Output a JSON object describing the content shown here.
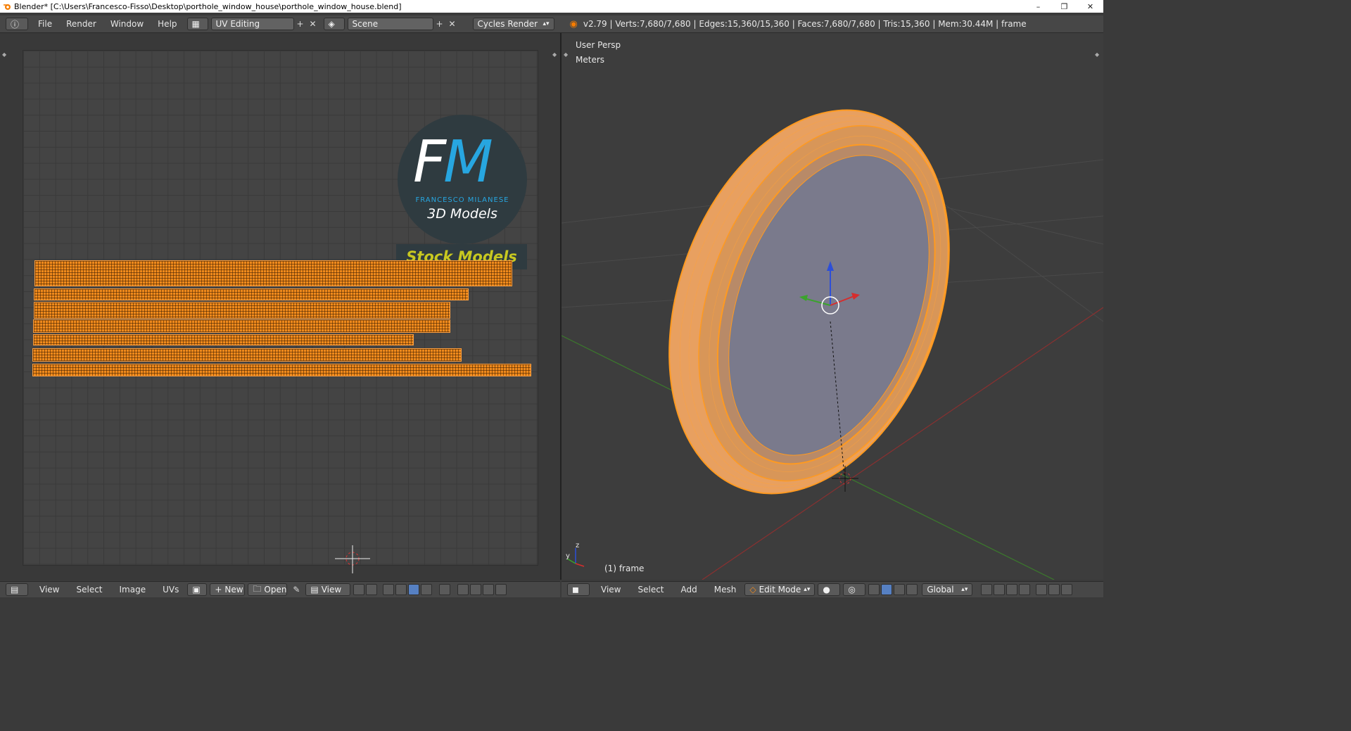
{
  "window": {
    "title": "Blender* [C:\\Users\\Francesco-Fisso\\Desktop\\porthole_window_house\\porthole_window_house.blend]",
    "minimize": "–",
    "maximize": "❐",
    "close": "✕"
  },
  "infobar": {
    "menus": [
      "File",
      "Render",
      "Window",
      "Help"
    ],
    "screen_layout": "UV Editing",
    "scene": "Scene",
    "render_engine": "Cycles Render",
    "stats": "v2.79 | Verts:7,680/7,680 | Edges:15,360/15,360 | Faces:7,680/7,680 | Tris:15,360 | Mem:30.44M | frame"
  },
  "uv_editor": {
    "logo_initials_f": "F",
    "logo_initials_m": "M",
    "logo_subtitle": "FRANCESCO MILANESE",
    "logo_tagline": "3D Models",
    "stock_label": "Stock Models",
    "footer": {
      "menus": [
        "View",
        "Select",
        "Image",
        "UVs"
      ],
      "new_label": "New",
      "open_label": "Open",
      "view_label": "View"
    }
  },
  "viewport": {
    "view_name": "User Persp",
    "units": "Meters",
    "object_label": "(1) frame",
    "axis_y": "y",
    "axis_z": "z",
    "footer": {
      "menus": [
        "View",
        "Select",
        "Add",
        "Mesh"
      ],
      "mode": "Edit Mode",
      "orientation": "Global"
    }
  },
  "colors": {
    "selection_orange": "#f08a1c",
    "grid_bg": "#444444",
    "logo_blue": "#27a6e0",
    "stock_yellow": "#c8c820",
    "inner_disc": "#7a7a8c"
  }
}
